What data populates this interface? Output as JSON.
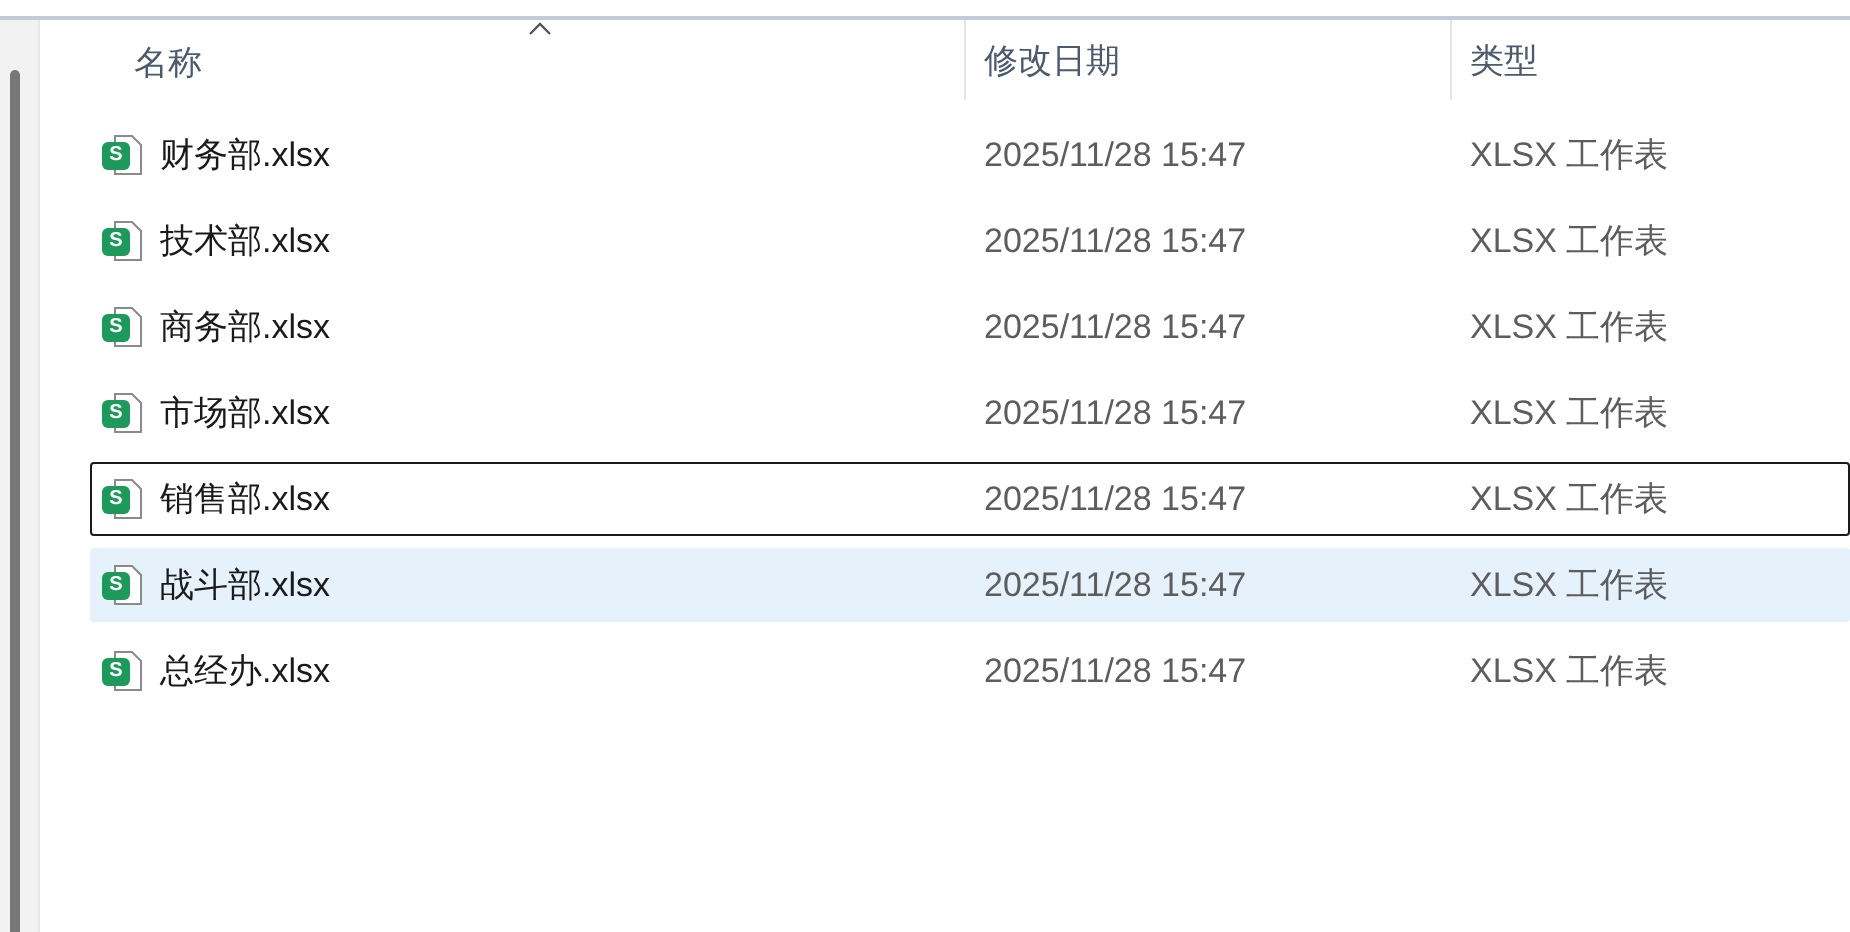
{
  "columns": [
    {
      "label": "名称",
      "sorted": true
    },
    {
      "label": "修改日期",
      "sorted": false
    },
    {
      "label": "类型",
      "sorted": false
    }
  ],
  "rows": [
    {
      "icon_letter": "S",
      "name": "财务部.xlsx",
      "modified": "2025/11/28 15:47",
      "type": "XLSX 工作表",
      "focused": false,
      "hovered": false
    },
    {
      "icon_letter": "S",
      "name": "技术部.xlsx",
      "modified": "2025/11/28 15:47",
      "type": "XLSX 工作表",
      "focused": false,
      "hovered": false
    },
    {
      "icon_letter": "S",
      "name": "商务部.xlsx",
      "modified": "2025/11/28 15:47",
      "type": "XLSX 工作表",
      "focused": false,
      "hovered": false
    },
    {
      "icon_letter": "S",
      "name": "市场部.xlsx",
      "modified": "2025/11/28 15:47",
      "type": "XLSX 工作表",
      "focused": false,
      "hovered": false
    },
    {
      "icon_letter": "S",
      "name": "销售部.xlsx",
      "modified": "2025/11/28 15:47",
      "type": "XLSX 工作表",
      "focused": true,
      "hovered": false
    },
    {
      "icon_letter": "S",
      "name": "战斗部.xlsx",
      "modified": "2025/11/28 15:47",
      "type": "XLSX 工作表",
      "focused": false,
      "hovered": true
    },
    {
      "icon_letter": "S",
      "name": "总经办.xlsx",
      "modified": "2025/11/28 15:47",
      "type": "XLSX 工作表",
      "focused": false,
      "hovered": false
    }
  ]
}
